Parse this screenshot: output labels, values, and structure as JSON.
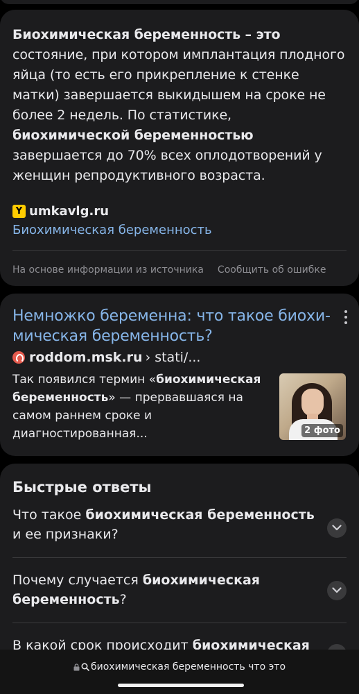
{
  "snippet": {
    "parts": [
      {
        "t": "Биохимическая беременность",
        "b": true
      },
      {
        "t": " – это",
        "b": true
      },
      {
        "t": " состояние, при котором имплантация плодного яйца (то есть его прикрепление к стенке матки) завершается выкидышем на сроке не более 2 недель. По статистике, ",
        "b": false
      },
      {
        "t": "биохимической беременностью",
        "b": true
      },
      {
        "t": " завершается до 70% всех оплодотворений у женщин репродуктивного возраста.",
        "b": false
      }
    ],
    "favicon_letter": "Y",
    "source_domain": "umkavlg.ru",
    "source_link": "Биохимическая беременность",
    "footer_info": "На основе информации из источника",
    "footer_report": "Сообщить об ошибке"
  },
  "result": {
    "title": "Немножко беременна: что такое биохи­мическая беременность?",
    "domain": "roddom.msk.ru",
    "path": "› stati/...",
    "desc_parts": [
      {
        "t": "Так появился термин «",
        "b": false
      },
      {
        "t": "биохимическая беременность",
        "b": true
      },
      {
        "t": "» — прервавшаяся на самом раннем сроке и диагностированная...",
        "b": false
      }
    ],
    "photo_badge": "2 фото"
  },
  "faq": {
    "title": "Быстрые ответы",
    "items": [
      [
        {
          "t": "Что такое ",
          "b": false
        },
        {
          "t": "биохимическая беременность",
          "b": true
        },
        {
          "t": " и ее признаки?",
          "b": false
        }
      ],
      [
        {
          "t": "Почему случается ",
          "b": false
        },
        {
          "t": "биохимическая беременность",
          "b": true
        },
        {
          "t": "?",
          "b": false
        }
      ],
      [
        {
          "t": "В какой срок происходит ",
          "b": false
        },
        {
          "t": "биохимическая",
          "b": true
        }
      ]
    ]
  },
  "bottom_bar": {
    "url_text": "биохимическая беременность что это"
  },
  "icons": {
    "more": "more-vertical-icon",
    "expand": "chevron-down-icon",
    "lock": "lock-icon",
    "search": "search-icon"
  },
  "colors": {
    "link": "#86b5e8",
    "card": "#1c1c1e",
    "yandex_favicon": "#ffcc00"
  }
}
